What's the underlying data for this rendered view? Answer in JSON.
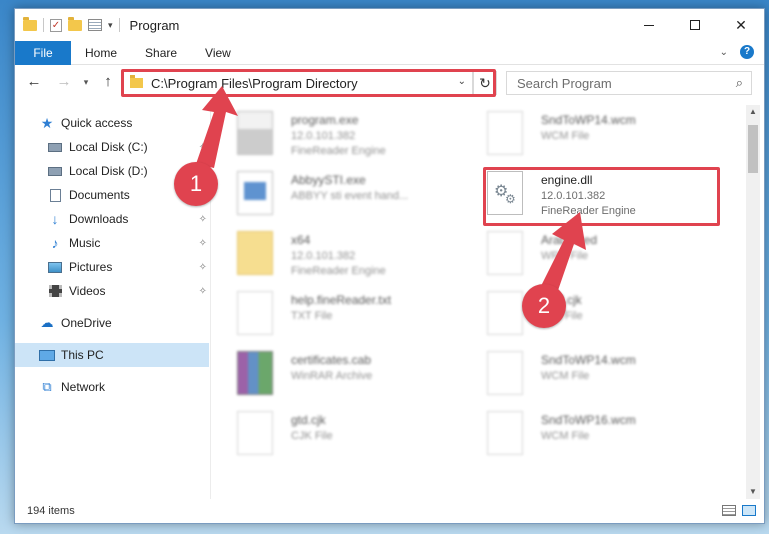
{
  "window": {
    "title": "Program",
    "controls": {
      "minimize": "",
      "maximize": "",
      "close": "✕"
    }
  },
  "ribbon": {
    "tabs": [
      "File",
      "Home",
      "Share",
      "View"
    ],
    "help": "?",
    "expand": "⌄"
  },
  "nav": {
    "back": "←",
    "forward": "→",
    "recent": "▾",
    "up": "↑",
    "address": "C:\\Program Files\\Program Directory",
    "address_dropdown": "⌄",
    "refresh": "↻",
    "search_placeholder": "Search Program",
    "search_icon": "⌕"
  },
  "sidebar": {
    "items": [
      {
        "label": "Quick access",
        "icon": "star-icon",
        "pinned": false
      },
      {
        "label": "Local Disk (C:)",
        "icon": "disk-icon",
        "pinned": true
      },
      {
        "label": "Local Disk (D:)",
        "icon": "disk-icon",
        "pinned": false
      },
      {
        "label": "Documents",
        "icon": "document-icon",
        "pinned": false
      },
      {
        "label": "Downloads",
        "icon": "download-icon",
        "pinned": true
      },
      {
        "label": "Music",
        "icon": "music-icon",
        "pinned": true
      },
      {
        "label": "Pictures",
        "icon": "pictures-icon",
        "pinned": true
      },
      {
        "label": "Videos",
        "icon": "videos-icon",
        "pinned": true
      },
      {
        "label": "OneDrive",
        "icon": "cloud-icon",
        "pinned": false
      },
      {
        "label": "This PC",
        "icon": "pc-icon",
        "pinned": false,
        "selected": true
      },
      {
        "label": "Network",
        "icon": "network-icon",
        "pinned": false
      }
    ],
    "pin_glyph": "✧"
  },
  "files": [
    {
      "name": "program.exe",
      "line1": "12.0.101.382",
      "line2": "FineReader Engine",
      "kind": "exe",
      "blurred": true
    },
    {
      "name": "SndToWP14.wcm",
      "line1": "WCM File",
      "line2": "",
      "kind": "blank",
      "blurred": true
    },
    {
      "name": "AbbyySTI.exe",
      "line1": "ABBYY sti event hand...",
      "line2": "",
      "kind": "blue",
      "blurred": true
    },
    {
      "name": "engine.dll",
      "line1": "12.0.101.382",
      "line2": "FineReader Engine",
      "kind": "dll",
      "blurred": false
    },
    {
      "name": "x64",
      "line1": "12.0.101.382",
      "line2": "FineReader Engine",
      "kind": "folder",
      "blurred": true
    },
    {
      "name": "ArabicRed",
      "line1": "WRD File",
      "line2": "",
      "kind": "blank",
      "blurred": true
    },
    {
      "name": "help.fineReader.txt",
      "line1": "TXT File",
      "line2": "",
      "kind": "blank",
      "blurred": true
    },
    {
      "name": "html.cjk",
      "line1": "CJK File",
      "line2": "",
      "kind": "blank",
      "blurred": true
    },
    {
      "name": "certificates.cab",
      "line1": "WinRAR Archive",
      "line2": "",
      "kind": "rar",
      "blurred": true
    },
    {
      "name": "SndToWP14.wcm",
      "line1": "WCM File",
      "line2": "",
      "kind": "blank",
      "blurred": true
    },
    {
      "name": "gtd.cjk",
      "line1": "CJK File",
      "line2": "",
      "kind": "blank",
      "blurred": true
    },
    {
      "name": "SndToWP16.wcm",
      "line1": "WCM File",
      "line2": "",
      "kind": "blank",
      "blurred": true
    }
  ],
  "callouts": [
    "1",
    "2"
  ],
  "status": {
    "count": "194 items"
  },
  "colors": {
    "accent": "#1979ca",
    "highlight": "#e0434f",
    "selected": "#cce4f7"
  }
}
